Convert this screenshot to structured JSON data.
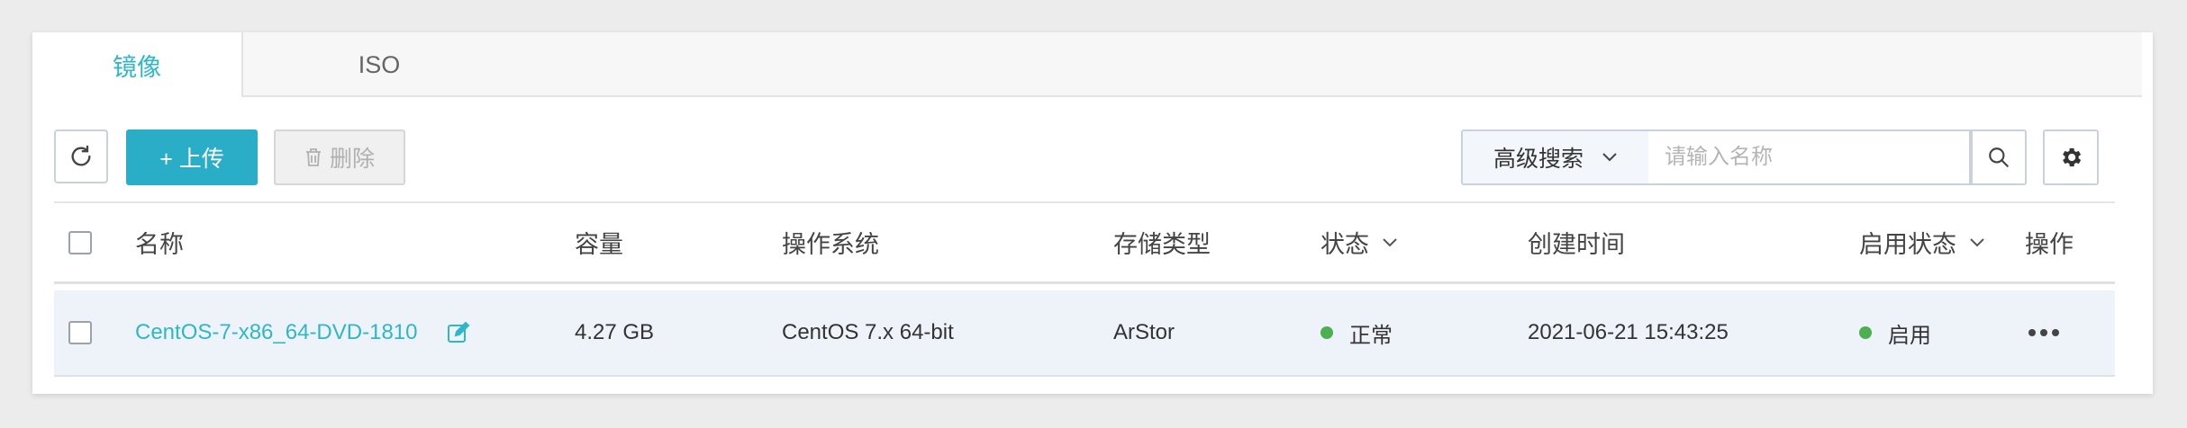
{
  "tabs": [
    {
      "label": "镜像",
      "active": true
    },
    {
      "label": "ISO",
      "active": false
    }
  ],
  "toolbar": {
    "upload_label": "+ 上传",
    "delete_label": "删除",
    "advanced_search_label": "高级搜索",
    "search_placeholder": "请输入名称"
  },
  "table": {
    "columns": [
      "名称",
      "容量",
      "操作系统",
      "存储类型",
      "状态",
      "创建时间",
      "启用状态",
      "操作"
    ],
    "rows": [
      {
        "name": "CentOS-7-x86_64-DVD-1810",
        "capacity": "4.27 GB",
        "os": "CentOS 7.x 64-bit",
        "storage_type": "ArStor",
        "status": "正常",
        "created_at": "2021-06-21 15:43:25",
        "enabled_status": "启用"
      }
    ]
  },
  "colors": {
    "accent": "#2aadc7",
    "link": "#2db7c9",
    "status_ok": "#4caf50"
  },
  "icons": {
    "refresh": "refresh-icon",
    "delete": "trash-icon",
    "search": "search-icon",
    "settings": "gear-icon",
    "edit": "edit-icon",
    "more": "more-horizontal-icon"
  }
}
